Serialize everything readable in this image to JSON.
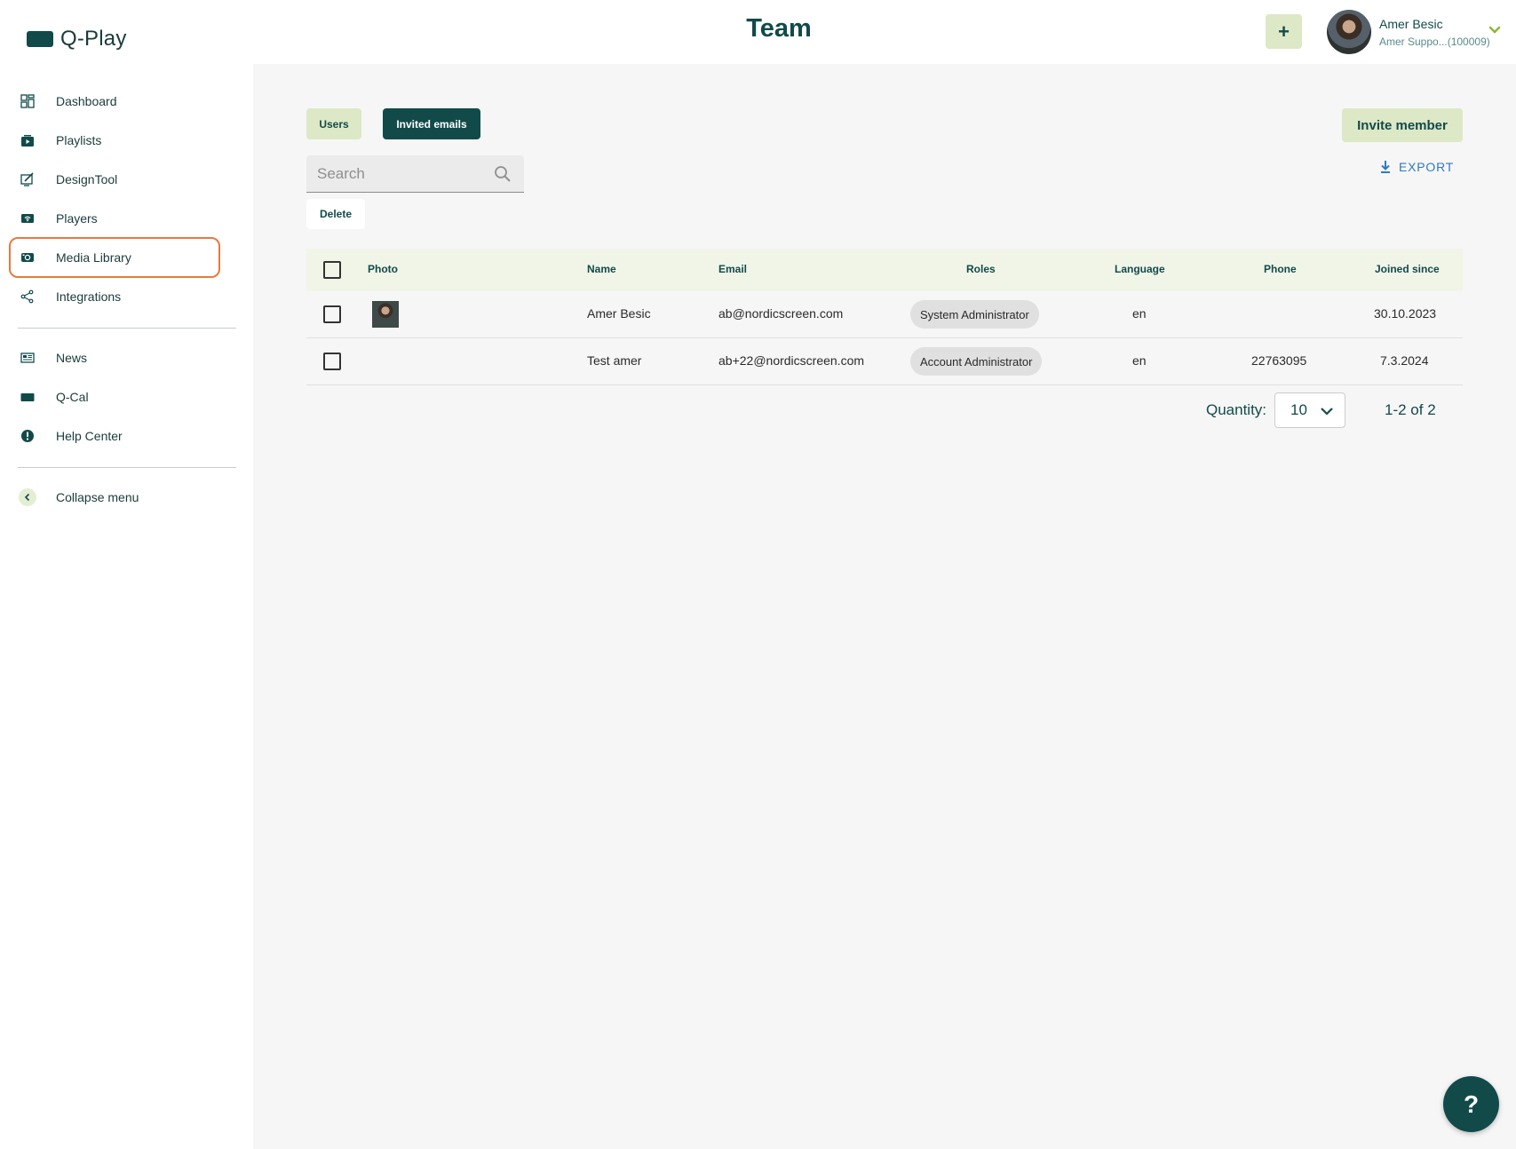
{
  "app": {
    "logo_text": "Q-Play",
    "page_title": "Team"
  },
  "header": {
    "plus_label": "+",
    "user_name": "Amer Besic",
    "user_sub": "Amer Suppo...(100009)"
  },
  "sidebar": {
    "items": [
      {
        "label": "Dashboard",
        "icon": "dashboard-icon"
      },
      {
        "label": "Playlists",
        "icon": "playlist-icon"
      },
      {
        "label": "DesignTool",
        "icon": "design-tool-icon"
      },
      {
        "label": "Players",
        "icon": "players-icon"
      },
      {
        "label": "Media Library",
        "icon": "media-library-icon",
        "selected": true
      },
      {
        "label": "Integrations",
        "icon": "integrations-icon"
      },
      {
        "label": "News",
        "icon": "news-icon"
      },
      {
        "label": "Q-Cal",
        "icon": "calendar-icon"
      },
      {
        "label": "Help Center",
        "icon": "help-icon"
      },
      {
        "label": "Collapse menu",
        "icon": "collapse-icon"
      }
    ]
  },
  "toolbar": {
    "tab_users": "Users",
    "tab_invited": "Invited emails",
    "invite_label": "Invite member",
    "search_placeholder": "Search",
    "export_label": "EXPORT",
    "delete_label": "Delete"
  },
  "table": {
    "headers": {
      "photo": "Photo",
      "name": "Name",
      "email": "Email",
      "roles": "Roles",
      "language": "Language",
      "phone": "Phone",
      "joined": "Joined since"
    },
    "rows": [
      {
        "name": "Amer Besic",
        "email": "ab@nordicscreen.com",
        "role": "System Administrator",
        "language": "en",
        "phone": "",
        "joined": "30.10.2023"
      },
      {
        "name": "Test amer",
        "email": "ab+22@nordicscreen.com",
        "role": "Account Administrator",
        "language": "en",
        "phone": "22763095",
        "joined": "7.3.2024"
      }
    ]
  },
  "pager": {
    "quantity_label": "Quantity:",
    "quantity_value": "10",
    "range": "1-2 of 2"
  },
  "help_fab": "?",
  "colors": {
    "brand": "#124a4a",
    "accent_light": "#dde8c6",
    "selected_outline": "#e8793e",
    "link": "#2f7ac2"
  }
}
